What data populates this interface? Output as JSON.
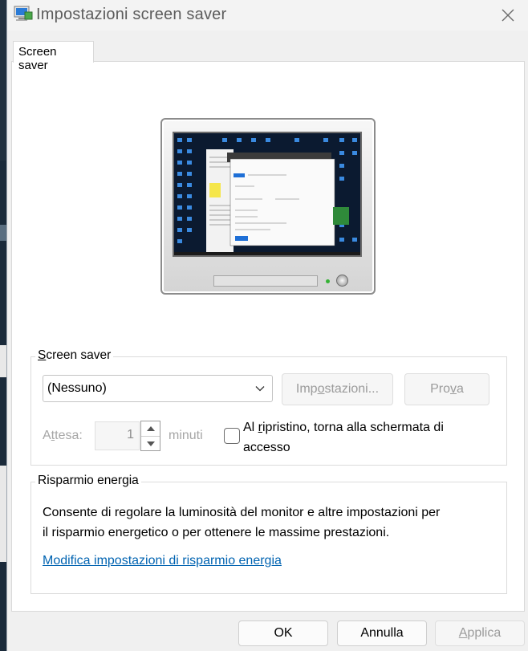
{
  "window": {
    "title": "Impostazioni screen saver",
    "icon": "screen-saver-app-icon",
    "close_icon": "close-icon"
  },
  "tabs": [
    {
      "label": "Screen saver",
      "selected": true
    }
  ],
  "screensaver_group": {
    "title_prefix": "S",
    "title_rest": "creen saver",
    "selected_option": "(Nessuno)",
    "settings_button": {
      "pre": "Imp",
      "u": "o",
      "post": "stazioni..."
    },
    "preview_button": {
      "pre": "Pro",
      "u": "v",
      "post": "a"
    },
    "wait_label": {
      "pre": "A",
      "u": "t",
      "post": "tesa:"
    },
    "wait_value": "1",
    "wait_unit": "minuti",
    "resume_checkbox": {
      "checked": false,
      "line1_pre": "Al ",
      "line1_u": "r",
      "line1_post": "ipristino, torna alla schermata di",
      "line2": "accesso"
    }
  },
  "power_group": {
    "title": "Risparmio energia",
    "description_line1": "Consente di regolare la luminosità del monitor e altre impostazioni per",
    "description_line2": "il risparmio energetico o per ottenere le massime prestazioni.",
    "link": "Modifica impostazioni di risparmio energia"
  },
  "footer": {
    "ok": "OK",
    "cancel": "Annulla",
    "apply_pre": "",
    "apply_u": "A",
    "apply_post": "pplica"
  },
  "colors": {
    "link": "#0063b1",
    "disabled_text": "#9b9b9b",
    "panel": "#ffffff",
    "dialog": "#f0f0f0"
  }
}
